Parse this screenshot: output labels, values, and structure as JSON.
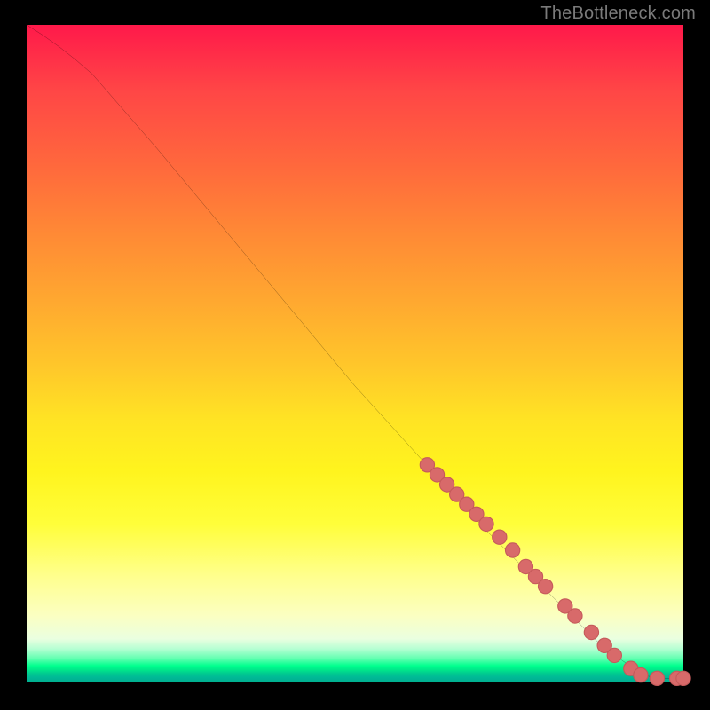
{
  "watermark": "TheBottleneck.com",
  "colors": {
    "line": "#000000",
    "marker_fill": "#d86a6a",
    "marker_stroke": "#c55a5a",
    "background_black": "#000000"
  },
  "chart_data": {
    "type": "line",
    "title": "",
    "xlabel": "",
    "ylabel": "",
    "xlim": [
      0,
      100
    ],
    "ylim": [
      0,
      100
    ],
    "grid": false,
    "legend": false,
    "curve": [
      {
        "x": 0,
        "y": 100
      },
      {
        "x": 5,
        "y": 97
      },
      {
        "x": 10,
        "y": 92.5
      },
      {
        "x": 20,
        "y": 81
      },
      {
        "x": 30,
        "y": 69
      },
      {
        "x": 40,
        "y": 57
      },
      {
        "x": 50,
        "y": 45
      },
      {
        "x": 60,
        "y": 34
      },
      {
        "x": 70,
        "y": 23
      },
      {
        "x": 80,
        "y": 13
      },
      {
        "x": 88,
        "y": 5
      },
      {
        "x": 94,
        "y": 1
      },
      {
        "x": 96,
        "y": 0.5
      },
      {
        "x": 100,
        "y": 0.5
      }
    ],
    "markers": [
      {
        "x": 61,
        "y": 33
      },
      {
        "x": 62.5,
        "y": 31.5
      },
      {
        "x": 64,
        "y": 30
      },
      {
        "x": 65.5,
        "y": 28.5
      },
      {
        "x": 67,
        "y": 27
      },
      {
        "x": 68.5,
        "y": 25.5
      },
      {
        "x": 70,
        "y": 24
      },
      {
        "x": 72,
        "y": 22
      },
      {
        "x": 74,
        "y": 20
      },
      {
        "x": 76,
        "y": 17.5
      },
      {
        "x": 77.5,
        "y": 16
      },
      {
        "x": 79,
        "y": 14.5
      },
      {
        "x": 82,
        "y": 11.5
      },
      {
        "x": 83.5,
        "y": 10
      },
      {
        "x": 86,
        "y": 7.5
      },
      {
        "x": 88,
        "y": 5.5
      },
      {
        "x": 89.5,
        "y": 4
      },
      {
        "x": 92,
        "y": 2
      },
      {
        "x": 93.5,
        "y": 1
      },
      {
        "x": 96,
        "y": 0.5
      },
      {
        "x": 99,
        "y": 0.5
      },
      {
        "x": 100,
        "y": 0.5
      }
    ],
    "marker_radius": 1.1
  }
}
